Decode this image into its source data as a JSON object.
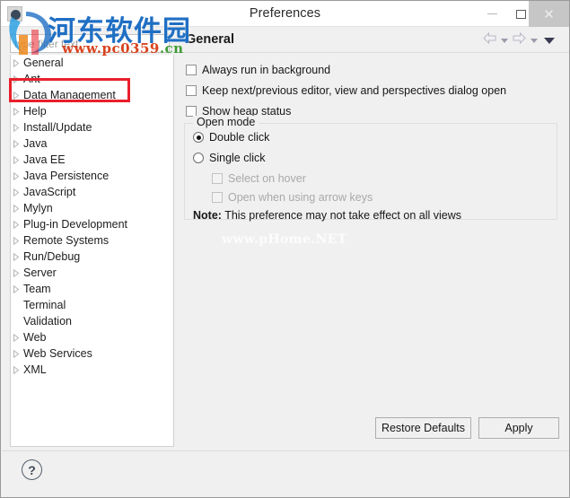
{
  "window": {
    "title": "Preferences",
    "app_icon": "eclipse-icon",
    "minimize_label": "–",
    "maximize_label": "☐",
    "close_label": "✕"
  },
  "header": {
    "page_title": "General",
    "nav": [
      {
        "name": "back-arrow-icon",
        "label": "⇦",
        "enabled": false
      },
      {
        "name": "back-dropdown-caret-icon",
        "label": "▾",
        "enabled": true
      },
      {
        "name": "forward-arrow-icon",
        "label": "⇨",
        "enabled": false
      },
      {
        "name": "forward-dropdown-caret-icon",
        "label": "▾",
        "enabled": true
      },
      {
        "name": "view-menu-caret-icon",
        "label": "▾",
        "enabled": true
      }
    ]
  },
  "sidebar": {
    "filter": {
      "placeholder": "type filter text",
      "value": ""
    },
    "selected": "General",
    "items": [
      {
        "label": "General",
        "expandable": true
      },
      {
        "label": "Ant",
        "expandable": true
      },
      {
        "label": "Data Management",
        "expandable": true
      },
      {
        "label": "Help",
        "expandable": true
      },
      {
        "label": "Install/Update",
        "expandable": true
      },
      {
        "label": "Java",
        "expandable": true
      },
      {
        "label": "Java EE",
        "expandable": true
      },
      {
        "label": "Java Persistence",
        "expandable": true
      },
      {
        "label": "JavaScript",
        "expandable": true
      },
      {
        "label": "Mylyn",
        "expandable": true
      },
      {
        "label": "Plug-in Development",
        "expandable": true
      },
      {
        "label": "Remote Systems",
        "expandable": true
      },
      {
        "label": "Run/Debug",
        "expandable": true
      },
      {
        "label": "Server",
        "expandable": true
      },
      {
        "label": "Team",
        "expandable": true
      },
      {
        "label": "Terminal",
        "expandable": false
      },
      {
        "label": "Validation",
        "expandable": false
      },
      {
        "label": "Web",
        "expandable": true
      },
      {
        "label": "Web Services",
        "expandable": true
      },
      {
        "label": "XML",
        "expandable": true
      }
    ]
  },
  "content": {
    "checkboxes": [
      {
        "label": "Always run in background",
        "checked": false,
        "enabled": true
      },
      {
        "label": "Keep next/previous editor, view and perspectives dialog open",
        "checked": false,
        "enabled": true
      },
      {
        "label": "Show heap status",
        "checked": false,
        "enabled": true
      }
    ],
    "open_mode": {
      "legend": "Open mode",
      "radios": [
        {
          "label": "Double click",
          "selected": true
        },
        {
          "label": "Single click",
          "selected": false
        }
      ],
      "sub_checkboxes": [
        {
          "label": "Select on hover",
          "checked": false,
          "enabled": false
        },
        {
          "label": "Open when using arrow keys",
          "checked": false,
          "enabled": false
        }
      ],
      "note_prefix": "Note:",
      "note_text": "This preference may not take effect on all views"
    }
  },
  "footer": {
    "restore_defaults_label": "Restore Defaults",
    "apply_label": "Apply"
  },
  "bottom": {
    "help_label": "?"
  },
  "watermarks": {
    "brand_cn": "河东软件园",
    "brand_url_main": "www.pc0359",
    "brand_url_tld": ".cn",
    "faint": "www.pHome.NET"
  },
  "colors": {
    "accent_blue": "#1f6fc4",
    "url_red": "#d9431e",
    "url_green": "#3f9b35",
    "annotation_red": "#e8202a",
    "dialog_bg": "#f0f0f0",
    "panel_white": "#ffffff"
  }
}
